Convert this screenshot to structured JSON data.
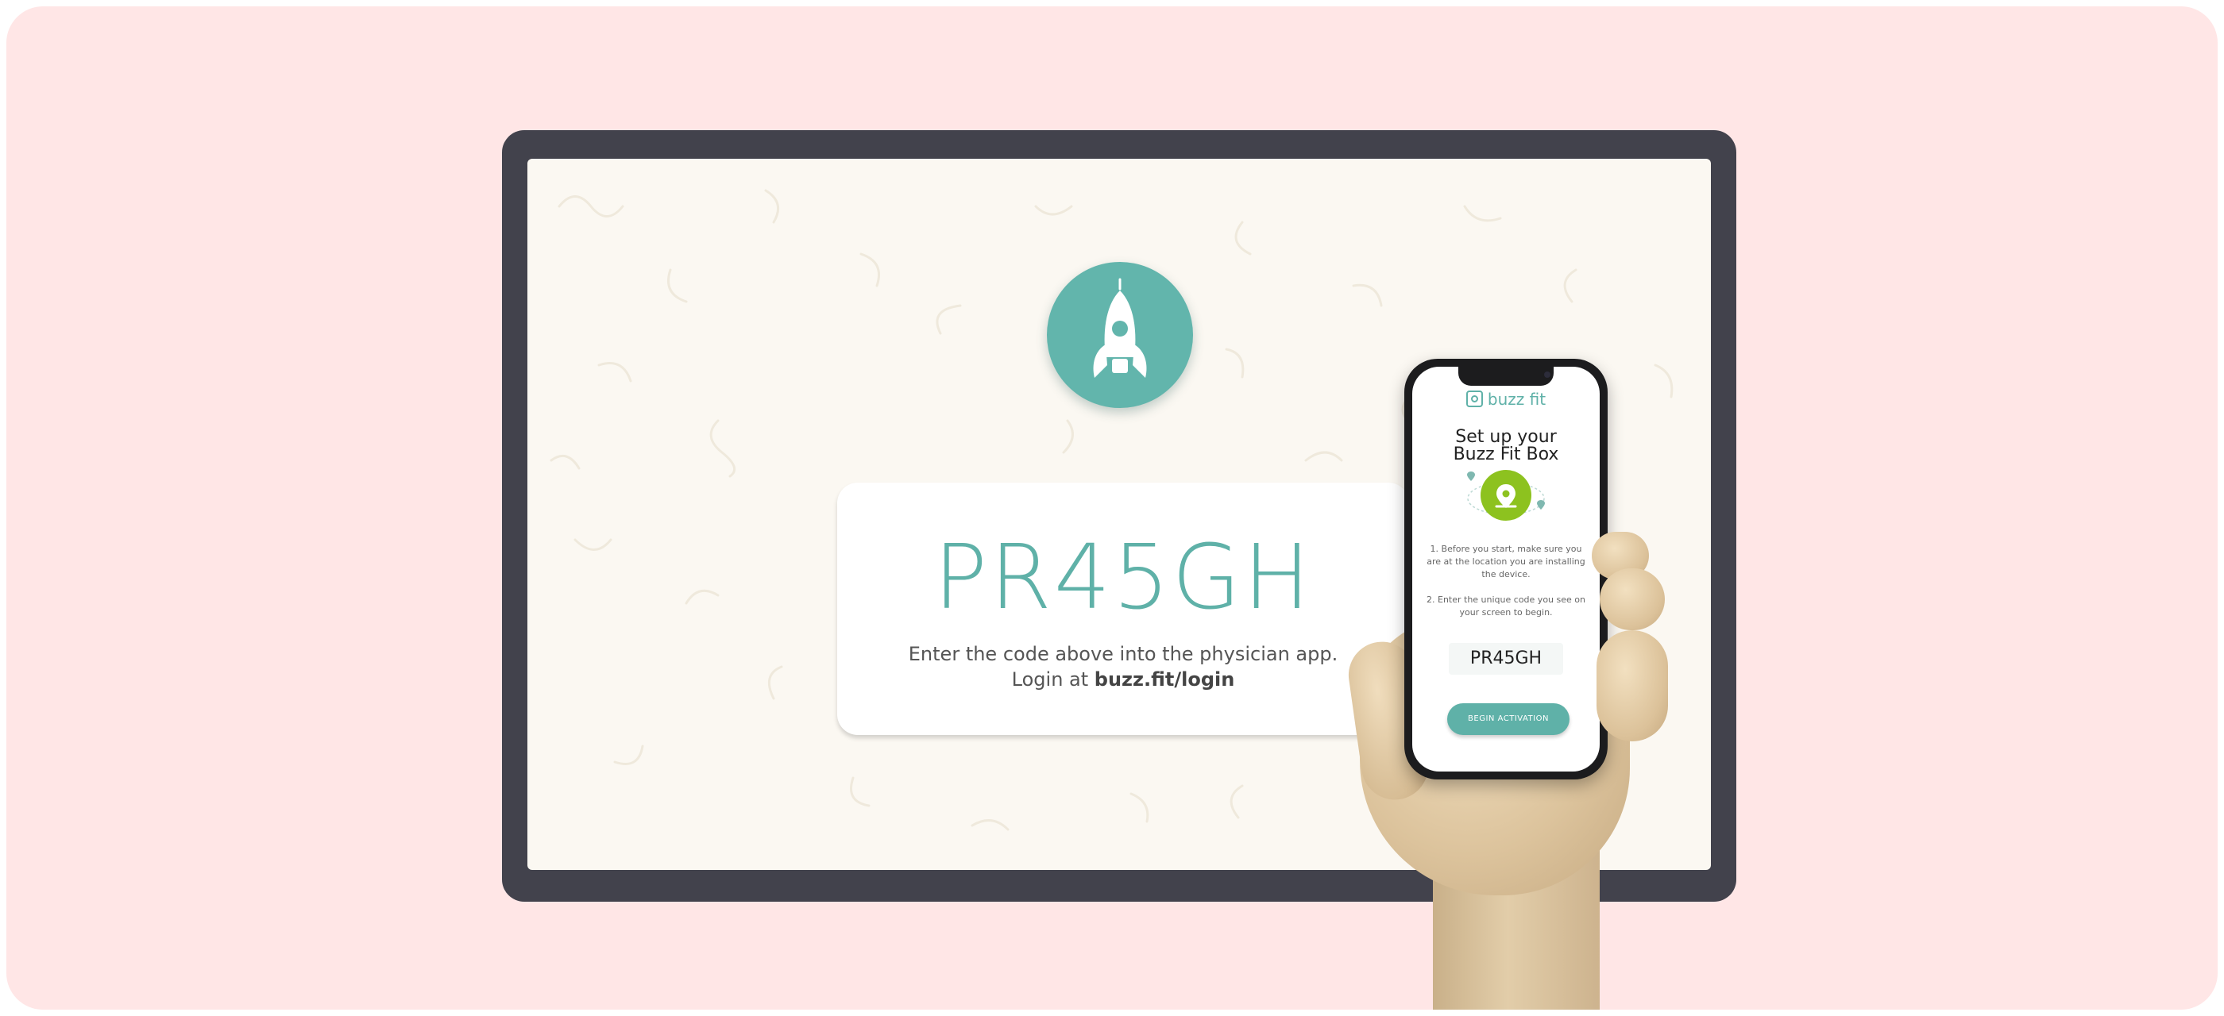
{
  "tv_screen": {
    "code": "PR45GH",
    "instruction_line1": "Enter the code above into the physician app.",
    "instruction_line2_prefix": "Login at ",
    "login_url": "buzz.fit/login"
  },
  "phone": {
    "brand": "buzz fit",
    "title_line1": "Set up your",
    "title_line2": "Buzz Fit Box",
    "step1": "1. Before you start, make sure you are at the location you are installing the device.",
    "step2": "2. Enter the unique code you see on your screen to begin.",
    "code": "PR45GH",
    "begin_button": "BEGIN ACTIVATION"
  },
  "colors": {
    "background": "#ffe6e6",
    "monitor_bezel": "#42424c",
    "screen": "#fbf8f2",
    "accent_teal": "#5fb1a8",
    "pin_green": "#8dc21f"
  },
  "icons": {
    "rocket": "rocket-icon",
    "brand_logo": "buzz-fit-logo-icon",
    "location": "location-pin-icon"
  }
}
